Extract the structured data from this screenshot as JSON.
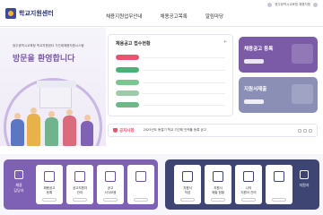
{
  "header": {
    "logo_text": "학교지원센터",
    "nav": [
      "채용지원업무안내",
      "채용공고목록",
      "알림마당"
    ],
    "util_text": "광주광역시교육청 채용지원"
  },
  "hero": {
    "subtitle": "광주광역시교육청 학교지원센터 기간제채용지원시스템",
    "welcome": "방문을 환영합니다"
  },
  "recruit": {
    "title": "채용공고 접수현황",
    "more_label": "+"
  },
  "cards": [
    {
      "title": "채용공고 등록"
    },
    {
      "title": "지원서제출"
    }
  ],
  "notice": {
    "label": "공지사항",
    "text": "2025년도 동절기 학교 기간제 인력풀 등록 공고"
  },
  "bottom": {
    "left_label": "채용\n담당자",
    "left_items": [
      "채용공고\n등록",
      "공고지원자\n관리",
      "공고\n서식모음",
      ""
    ],
    "right_label": "지원자",
    "right_items": [
      "지원서\n작성",
      "지원서\n제출 현황",
      "나의\n지원서 관리",
      ""
    ]
  },
  "colors": {
    "primary_purple": "#7e61b5",
    "navy": "#3e4573",
    "accent_red": "#e9536f",
    "accent_green": "#4bb178"
  }
}
